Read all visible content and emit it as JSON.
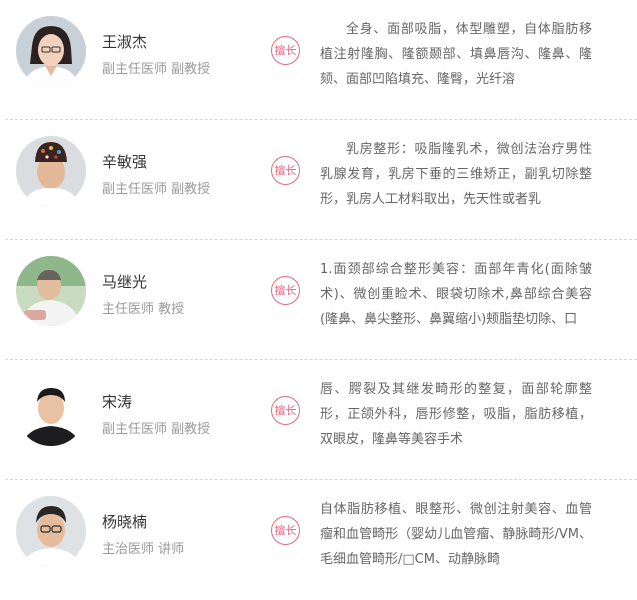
{
  "specialty_badge_label": "擅长",
  "accent_color": "#e06c84",
  "doctors": [
    {
      "name": "王淑杰",
      "titles": "副主任医师  副教授",
      "specialty": "全身、面部吸脂，体型雕塑，自体脂肪移植注射隆胸、隆额颞部、填鼻唇沟、隆鼻、隆颏、面部凹陷填充、隆臀，光纤溶",
      "avatar": "female-doctor-photo"
    },
    {
      "name": "辛敏强",
      "titles": "副主任医师  副教授",
      "specialty": "乳房整形：吸脂隆乳术，微创法治疗男性乳腺发育，乳房下垂的三维矫正，副乳切除整形，乳房人工材料取出，先天性或者乳",
      "avatar": "male-doctor-cap-photo"
    },
    {
      "name": "马继光",
      "titles": "主任医师  教授",
      "specialty": "1.面颈部综合整形美容：面部年青化(面除皱术)、微创重睑术、眼袋切除术,鼻部综合美容(隆鼻、鼻尖整形、鼻翼缩小)颊脂垫切除、口",
      "avatar": "senior-doctor-photo"
    },
    {
      "name": "宋涛",
      "titles": "副主任医师  副教授",
      "specialty": "唇、腭裂及其继发畸形的整复，面部轮廓整形，正颌外科，唇形修整，吸脂，脂肪移植，双眼皮，隆鼻等美容手术",
      "avatar": "male-doctor-photo"
    },
    {
      "name": "杨晓楠",
      "titles": "主治医师  讲师",
      "specialty": "自体脂肪移植、眼整形、微创注射美容、血管瘤和血管畸形（婴幼儿血管瘤、静脉畸形/VM、毛细血管畸形/□CM、动静脉畸",
      "avatar": "glasses-doctor-photo"
    }
  ]
}
